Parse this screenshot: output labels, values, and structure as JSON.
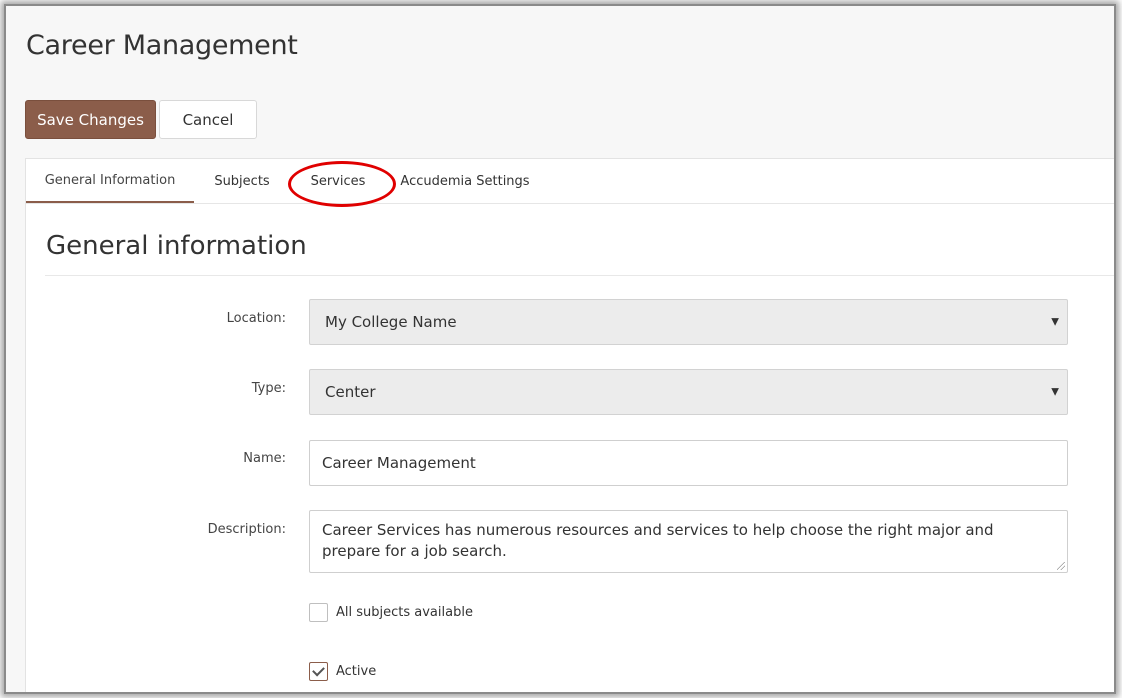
{
  "header": {
    "title": "Career Management"
  },
  "toolbar": {
    "save_label": "Save Changes",
    "cancel_label": "Cancel"
  },
  "tabs": [
    {
      "label": "General Information",
      "active": true
    },
    {
      "label": "Subjects",
      "active": false
    },
    {
      "label": "Services",
      "active": false,
      "highlighted": true
    },
    {
      "label": "Accudemia Settings",
      "active": false
    }
  ],
  "section": {
    "title": "General information"
  },
  "form": {
    "location": {
      "label": "Location:",
      "value": "My College Name"
    },
    "type": {
      "label": "Type:",
      "value": "Center"
    },
    "name": {
      "label": "Name:",
      "value": "Career Management"
    },
    "description": {
      "label": "Description:",
      "value": "Career Services has numerous resources and services to help choose the right major and prepare for a job search."
    },
    "all_subjects": {
      "label": "All subjects available",
      "checked": false
    },
    "active": {
      "label": "Active",
      "checked": true
    }
  },
  "colors": {
    "accent": "#8b5d4a",
    "highlight": "#e00000"
  }
}
